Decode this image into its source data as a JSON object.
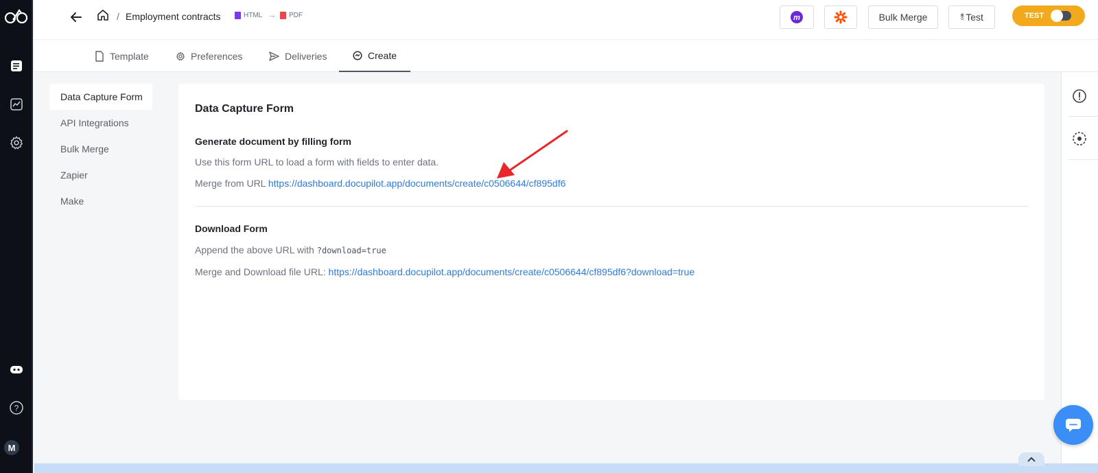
{
  "header": {
    "breadcrumb_sep": "/",
    "title": "Employment contracts",
    "format_from": "HTML",
    "format_to": "PDF",
    "buttons": {
      "bulk_merge": "Bulk Merge",
      "test": "Test"
    },
    "mode_toggle": {
      "label": "TEST",
      "state": "test"
    }
  },
  "tabs": [
    {
      "label": "Template",
      "icon": "file-icon"
    },
    {
      "label": "Preferences",
      "icon": "gear-icon"
    },
    {
      "label": "Deliveries",
      "icon": "send-icon"
    },
    {
      "label": "Create",
      "icon": "create-icon",
      "active": true
    }
  ],
  "subnav": [
    {
      "label": "Data Capture Form",
      "active": true
    },
    {
      "label": "API Integrations"
    },
    {
      "label": "Bulk Merge"
    },
    {
      "label": "Zapier"
    },
    {
      "label": "Make"
    }
  ],
  "main": {
    "heading": "Data Capture Form",
    "section1": {
      "title": "Generate document by filling form",
      "description": "Use this form URL to load a form with fields to enter data.",
      "url_label": "Merge from URL",
      "url": "https://dashboard.docupilot.app/documents/create/c0506644/cf895df6"
    },
    "section2": {
      "title": "Download Form",
      "description_prefix": "Append the above URL with",
      "param": "?download=true",
      "url_label": "Merge and Download file URL:",
      "url": "https://dashboard.docupilot.app/documents/create/c0506644/cf895df6?download=true"
    }
  },
  "sidebar": {
    "avatar_initial": "M"
  },
  "colors": {
    "accent": "#2f7bd6",
    "toggle": "#f2a91b",
    "rail": "#0d1117",
    "chat": "#3a8ef6",
    "annotation_arrow": "#e8262b"
  }
}
